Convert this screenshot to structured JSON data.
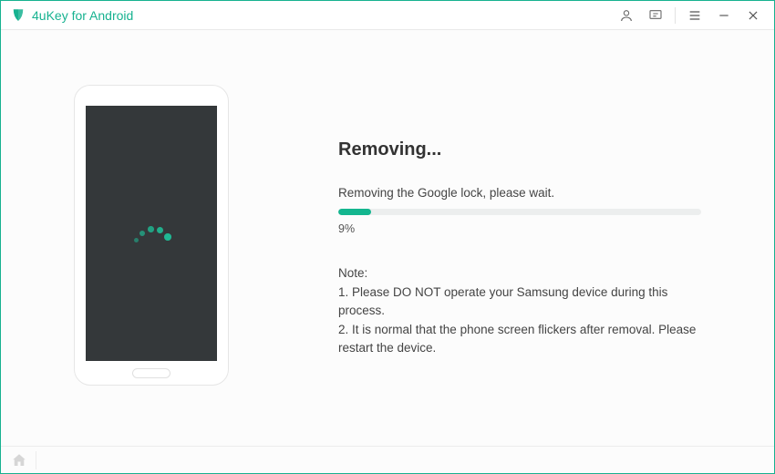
{
  "app": {
    "title": "4uKey for Android"
  },
  "progress": {
    "title": "Removing...",
    "message": "Removing the Google lock, please wait.",
    "percent": 9,
    "percent_label": "9%"
  },
  "notes": {
    "heading": "Note:",
    "items": [
      "1. Please DO NOT operate your Samsung device during this process.",
      "2. It is normal that the phone screen flickers after removal. Please restart the device."
    ]
  }
}
